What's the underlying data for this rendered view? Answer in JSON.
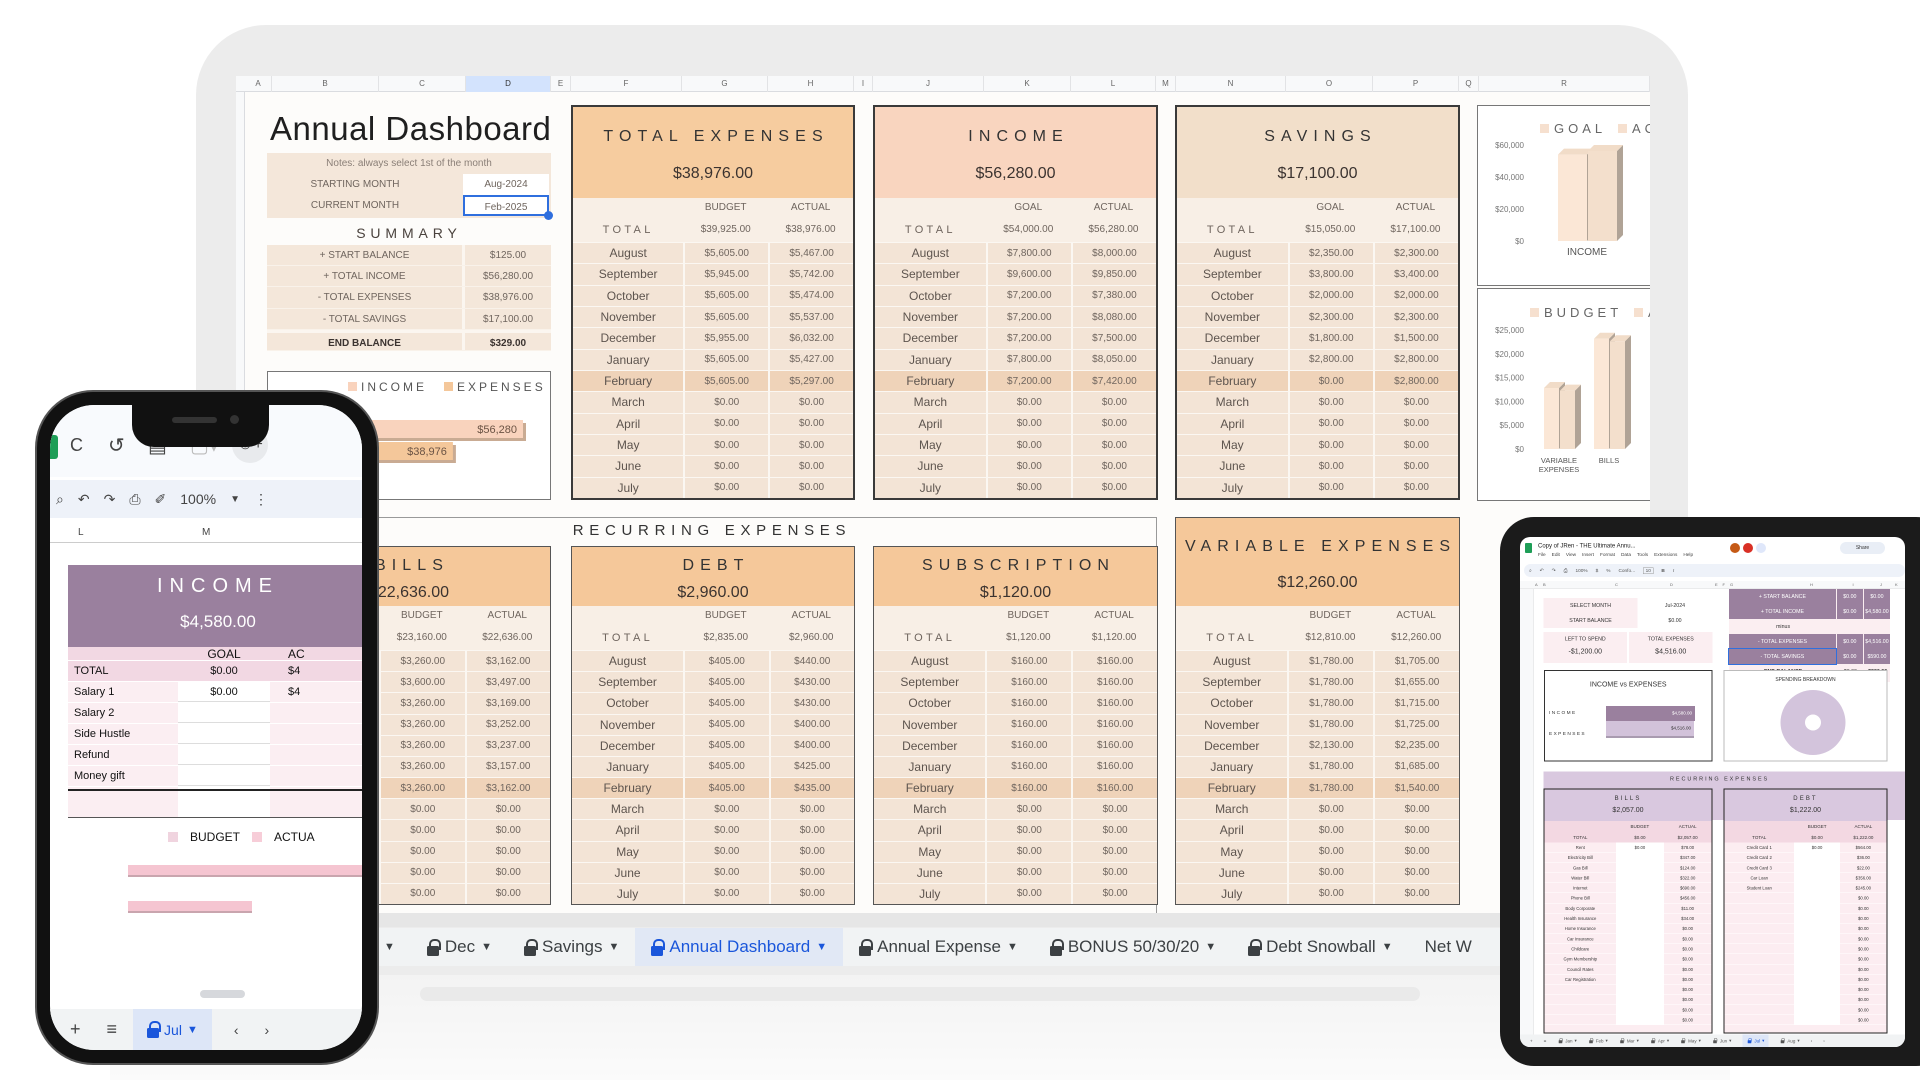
{
  "sheet": {
    "columns": [
      "A",
      "B",
      "C",
      "D",
      "E",
      "F",
      "G",
      "H",
      "I",
      "J",
      "K",
      "L",
      "M",
      "N",
      "O",
      "P",
      "Q",
      "R"
    ],
    "selected_column": "D",
    "title": "Annual Dashboard",
    "notes": "Notes: always select 1st of the month",
    "starting_month_label": "STARTING MONTH",
    "starting_month": "Aug-2024",
    "current_month_label": "CURRENT MONTH",
    "current_month": "Feb-2025",
    "summary_title": "SUMMARY",
    "summary": [
      {
        "label": "+ START BALANCE",
        "value": "$125.00"
      },
      {
        "label": "+ TOTAL INCOME",
        "value": "$56,280.00"
      },
      {
        "label": "- TOTAL EXPENSES",
        "value": "$38,976.00"
      },
      {
        "label": "- TOTAL SAVINGS",
        "value": "$17,100.00"
      }
    ],
    "end_balance": {
      "label": "END BALANCE",
      "value": "$329.00"
    },
    "recurring_title": "RECURRING EXPENSES"
  },
  "months": [
    "August",
    "September",
    "October",
    "November",
    "December",
    "January",
    "February",
    "March",
    "April",
    "May",
    "June",
    "July"
  ],
  "panels": {
    "total_expenses": {
      "title": "TOTAL EXPENSES",
      "amount": "$38,976.00",
      "total_label": "TOTAL",
      "col1": "BUDGET",
      "col2": "ACTUAL",
      "total1": "$39,925.00",
      "total2": "$38,976.00",
      "v1": [
        "$5,605.00",
        "$5,945.00",
        "$5,605.00",
        "$5,605.00",
        "$5,955.00",
        "$5,605.00",
        "$5,605.00",
        "$0.00",
        "$0.00",
        "$0.00",
        "$0.00",
        "$0.00"
      ],
      "v2": [
        "$5,467.00",
        "$5,742.00",
        "$5,474.00",
        "$5,537.00",
        "$6,032.00",
        "$5,427.00",
        "$5,297.00",
        "$0.00",
        "$0.00",
        "$0.00",
        "$0.00",
        "$0.00"
      ]
    },
    "income": {
      "title": "INCOME",
      "amount": "$56,280.00",
      "total_label": "TOTAL",
      "col1": "GOAL",
      "col2": "ACTUAL",
      "total1": "$54,000.00",
      "total2": "$56,280.00",
      "v1": [
        "$7,800.00",
        "$9,600.00",
        "$7,200.00",
        "$7,200.00",
        "$7,200.00",
        "$7,800.00",
        "$7,200.00",
        "$0.00",
        "$0.00",
        "$0.00",
        "$0.00",
        "$0.00"
      ],
      "v2": [
        "$8,000.00",
        "$9,850.00",
        "$7,380.00",
        "$8,080.00",
        "$7,500.00",
        "$8,050.00",
        "$7,420.00",
        "$0.00",
        "$0.00",
        "$0.00",
        "$0.00",
        "$0.00"
      ]
    },
    "savings": {
      "title": "SAVINGS",
      "amount": "$17,100.00",
      "total_label": "TOTAL",
      "col1": "GOAL",
      "col2": "ACTUAL",
      "total1": "$15,050.00",
      "total2": "$17,100.00",
      "v1": [
        "$2,350.00",
        "$3,800.00",
        "$2,000.00",
        "$2,300.00",
        "$1,800.00",
        "$2,800.00",
        "$0.00",
        "$0.00",
        "$0.00",
        "$0.00",
        "$0.00",
        "$0.00"
      ],
      "v2": [
        "$2,300.00",
        "$3,400.00",
        "$2,000.00",
        "$2,300.00",
        "$1,500.00",
        "$2,800.00",
        "$2,800.00",
        "$0.00",
        "$0.00",
        "$0.00",
        "$0.00",
        "$0.00"
      ]
    },
    "bills": {
      "title": "BILLS",
      "amount": "$22,636.00",
      "total_label": "TOTAL",
      "col1": "BUDGET",
      "col2": "ACTUAL",
      "total1": "$23,160.00",
      "total2": "$22,636.00",
      "v1": [
        "$3,260.00",
        "$3,600.00",
        "$3,260.00",
        "$3,260.00",
        "$3,260.00",
        "$3,260.00",
        "$3,260.00",
        "$0.00",
        "$0.00",
        "$0.00",
        "$0.00",
        "$0.00"
      ],
      "v2": [
        "$3,162.00",
        "$3,497.00",
        "$3,169.00",
        "$3,252.00",
        "$3,237.00",
        "$3,157.00",
        "$3,162.00",
        "$0.00",
        "$0.00",
        "$0.00",
        "$0.00",
        "$0.00"
      ]
    },
    "debt": {
      "title": "DEBT",
      "amount": "$2,960.00",
      "total_label": "TOTAL",
      "col1": "BUDGET",
      "col2": "ACTUAL",
      "total1": "$2,835.00",
      "total2": "$2,960.00",
      "v1": [
        "$405.00",
        "$405.00",
        "$405.00",
        "$405.00",
        "$405.00",
        "$405.00",
        "$405.00",
        "$0.00",
        "$0.00",
        "$0.00",
        "$0.00",
        "$0.00"
      ],
      "v2": [
        "$440.00",
        "$430.00",
        "$430.00",
        "$400.00",
        "$400.00",
        "$425.00",
        "$435.00",
        "$0.00",
        "$0.00",
        "$0.00",
        "$0.00",
        "$0.00"
      ]
    },
    "subscription": {
      "title": "SUBSCRIPTION",
      "amount": "$1,120.00",
      "total_label": "TOTAL",
      "col1": "BUDGET",
      "col2": "ACTUAL",
      "total1": "$1,120.00",
      "total2": "$1,120.00",
      "v1": [
        "$160.00",
        "$160.00",
        "$160.00",
        "$160.00",
        "$160.00",
        "$160.00",
        "$160.00",
        "$0.00",
        "$0.00",
        "$0.00",
        "$0.00",
        "$0.00"
      ],
      "v2": [
        "$160.00",
        "$160.00",
        "$160.00",
        "$160.00",
        "$160.00",
        "$160.00",
        "$160.00",
        "$0.00",
        "$0.00",
        "$0.00",
        "$0.00",
        "$0.00"
      ]
    },
    "variable": {
      "title": "VARIABLE EXPENSES",
      "amount": "$12,260.00",
      "total_label": "TOTAL",
      "col1": "BUDGET",
      "col2": "ACTUAL",
      "total1": "$12,810.00",
      "total2": "$12,260.00",
      "v1": [
        "$1,780.00",
        "$1,780.00",
        "$1,780.00",
        "$1,780.00",
        "$2,130.00",
        "$1,780.00",
        "$1,780.00",
        "$0.00",
        "$0.00",
        "$0.00",
        "$0.00",
        "$0.00"
      ],
      "v2": [
        "$1,705.00",
        "$1,655.00",
        "$1,715.00",
        "$1,725.00",
        "$2,235.00",
        "$1,685.00",
        "$1,540.00",
        "$0.00",
        "$0.00",
        "$0.00",
        "$0.00",
        "$0.00"
      ]
    }
  },
  "chart_data": [
    {
      "type": "bar",
      "orientation": "horizontal",
      "series": [
        {
          "name": "INCOME",
          "values": [
            56280
          ]
        },
        {
          "name": "EXPENSES",
          "values": [
            38976
          ]
        }
      ],
      "data_labels": [
        "$56,280",
        "$38,976"
      ],
      "colors": [
        "#f9d3bd",
        "#f4c79a"
      ],
      "legend": "top"
    },
    {
      "type": "bar",
      "style": "3d",
      "categories": [
        "INCOME"
      ],
      "series": [
        {
          "name": "GOAL",
          "values": [
            54000
          ]
        },
        {
          "name": "ACTUAL",
          "values": [
            56280
          ]
        }
      ],
      "yticks": [
        "$0",
        "$20,000",
        "$40,000",
        "$60,000"
      ],
      "ylim": [
        0,
        60000
      ],
      "legend": "top",
      "colors": [
        "#fbe7d6",
        "#f3dfcc"
      ]
    },
    {
      "type": "bar",
      "style": "3d",
      "categories": [
        "VARIABLE EXPENSES",
        "BILLS"
      ],
      "series": [
        {
          "name": "BUDGET",
          "values": [
            12810,
            23160
          ]
        },
        {
          "name": "ACTUAL",
          "values": [
            12260,
            22636
          ]
        }
      ],
      "yticks": [
        "$0",
        "$5,000",
        "$10,000",
        "$15,000",
        "$20,000",
        "$25,000"
      ],
      "ylim": [
        0,
        25000
      ],
      "legend": "top",
      "colors": [
        "#fbe7d6",
        "#f3dfcc"
      ]
    }
  ],
  "tabs": [
    {
      "label": "Dec",
      "active": false
    },
    {
      "label": "Savings",
      "active": false
    },
    {
      "label": "Annual Dashboard",
      "active": true
    },
    {
      "label": "Annual Expense",
      "active": false
    },
    {
      "label": "BONUS 50/30/20",
      "active": false
    },
    {
      "label": "Debt Snowball",
      "active": false
    },
    {
      "label": "Net W",
      "active": false
    }
  ],
  "colors": {
    "accent": "#1a56db",
    "expenses_header": "#f6cc9f",
    "income_header": "#f9d5bf",
    "savings_header": "#f2dfca",
    "phone_purple": "#9a809e",
    "tablet_lilac": "#d9c8df"
  },
  "phone": {
    "menu_fragment": "C",
    "zoom": "100%",
    "columns": [
      "L",
      "M"
    ],
    "income_title": "INCOME",
    "income_amount": "$4,580.00",
    "goal_label": "GOAL",
    "actual_label": "AC",
    "rows": [
      {
        "label": "TOTAL",
        "goal": "$0.00",
        "actual": "$4"
      },
      {
        "label": "Salary 1",
        "goal": "$0.00",
        "actual": "$4"
      },
      {
        "label": "Salary 2",
        "goal": "",
        "actual": ""
      },
      {
        "label": "Side Hustle",
        "goal": "",
        "actual": ""
      },
      {
        "label": "Refund",
        "goal": "",
        "actual": ""
      },
      {
        "label": "Money gift",
        "goal": "",
        "actual": ""
      }
    ],
    "chart_legend": [
      "BUDGET",
      "ACTUA"
    ],
    "tab": "Jul"
  },
  "tablet": {
    "doc_title": "Copy of JRen - THE Ultimate Annu...",
    "menus": [
      "File",
      "Edit",
      "View",
      "Insert",
      "Format",
      "Data",
      "Tools",
      "Extensions",
      "Help"
    ],
    "share": "Share",
    "zoom": "100%",
    "font": "Confo...",
    "font_size": "10",
    "columns": [
      "A",
      "B",
      "C",
      "D",
      "E",
      "F",
      "G",
      "H",
      "I",
      "J",
      "K"
    ],
    "select_month_label": "SELECT MONTH",
    "select_month": "Jul-2024",
    "start_balance_label": "START BALANCE",
    "start_balance": "$0.00",
    "left_to_spend_label": "LEFT TO SPEND",
    "left_to_spend": "-$1,200.00",
    "total_expenses_label": "TOTAL EXPENSES",
    "total_expenses": "$4,516.00",
    "summary": [
      {
        "label": "+ START BALANCE",
        "a": "$0.00",
        "b": "$0.00"
      },
      {
        "label": "+ TOTAL INCOME",
        "a": "$0.00",
        "b": "$4,580.00"
      },
      {
        "label": "minus",
        "a": "",
        "b": ""
      },
      {
        "label": "- TOTAL EXPENSES",
        "a": "$0.00",
        "b": "$4,516.00"
      },
      {
        "label": "- TOTAL SAVINGS",
        "a": "$0.00",
        "b": "$590.00"
      },
      {
        "label": "END BALANCE",
        "a": "$0.00",
        "b": "-$526.00"
      }
    ],
    "ie_title": "INCOME vs EXPENSES",
    "ie_rows": [
      {
        "label": "INCOME",
        "value": "$4,580.00"
      },
      {
        "label": "EXPENSES",
        "value": "$4,516.00"
      }
    ],
    "spending_title": "SPENDING BREAKDOWN",
    "recurring_title": "RECURRING EXPENSES",
    "bills": {
      "title": "BILLS",
      "amount": "$2,057.00",
      "total_label": "TOTAL",
      "col1": "BUDGET",
      "col2": "ACTUAL",
      "total1": "$0.00",
      "total2": "$2,057.00",
      "rows": [
        [
          "Rent",
          "$0.00",
          "$78.00"
        ],
        [
          "Electricity Bill",
          "",
          "$347.00"
        ],
        [
          "Gas Bill",
          "",
          "$124.00"
        ],
        [
          "Water Bill",
          "",
          "$322.00"
        ],
        [
          "Internet",
          "",
          "$690.00"
        ],
        [
          "Phone Bill",
          "",
          "$456.00"
        ],
        [
          "Body Corporate",
          "",
          "$11.00"
        ],
        [
          "Health Insurance",
          "",
          "$34.00"
        ],
        [
          "Home Insurance",
          "",
          "$0.00"
        ],
        [
          "Car Insurance",
          "",
          "$0.00"
        ],
        [
          "Childcare",
          "",
          "$0.00"
        ],
        [
          "Gym Membership",
          "",
          "$0.00"
        ],
        [
          "Council Rates",
          "",
          "$0.00"
        ],
        [
          "Car Registration",
          "",
          "$0.00"
        ],
        [
          "",
          "",
          "$0.00"
        ],
        [
          "",
          "",
          "$0.00"
        ],
        [
          "",
          "",
          "$0.00"
        ],
        [
          "",
          "",
          "$0.00"
        ]
      ]
    },
    "debt": {
      "title": "DEBT",
      "amount": "$1,222.00",
      "total_label": "TOTAL",
      "col1": "BUDGET",
      "col2": "ACTUAL",
      "total1": "$0.00",
      "total2": "$1,222.00",
      "rows": [
        [
          "Credit Card 1",
          "$0.00",
          "$564.00"
        ],
        [
          "Credit Card 2",
          "",
          "$36.00"
        ],
        [
          "Credit Card 3",
          "",
          "$22.00"
        ],
        [
          "Car Loan",
          "",
          "$356.00"
        ],
        [
          "Student Loan",
          "",
          "$245.00"
        ],
        [
          "",
          "",
          "$0.00"
        ],
        [
          "",
          "",
          "$0.00"
        ],
        [
          "",
          "",
          "$0.00"
        ],
        [
          "",
          "",
          "$0.00"
        ],
        [
          "",
          "",
          "$0.00"
        ],
        [
          "",
          "",
          "$0.00"
        ],
        [
          "",
          "",
          "$0.00"
        ],
        [
          "",
          "",
          "$0.00"
        ],
        [
          "",
          "",
          "$0.00"
        ],
        [
          "",
          "",
          "$0.00"
        ],
        [
          "",
          "",
          "$0.00"
        ],
        [
          "",
          "",
          "$0.00"
        ],
        [
          "",
          "",
          "$0.00"
        ]
      ]
    },
    "tabs": [
      "Jan",
      "Feb",
      "Mar",
      "Apr",
      "May",
      "Jun",
      "Jul",
      "Aug"
    ],
    "active_tab": "Jul"
  }
}
